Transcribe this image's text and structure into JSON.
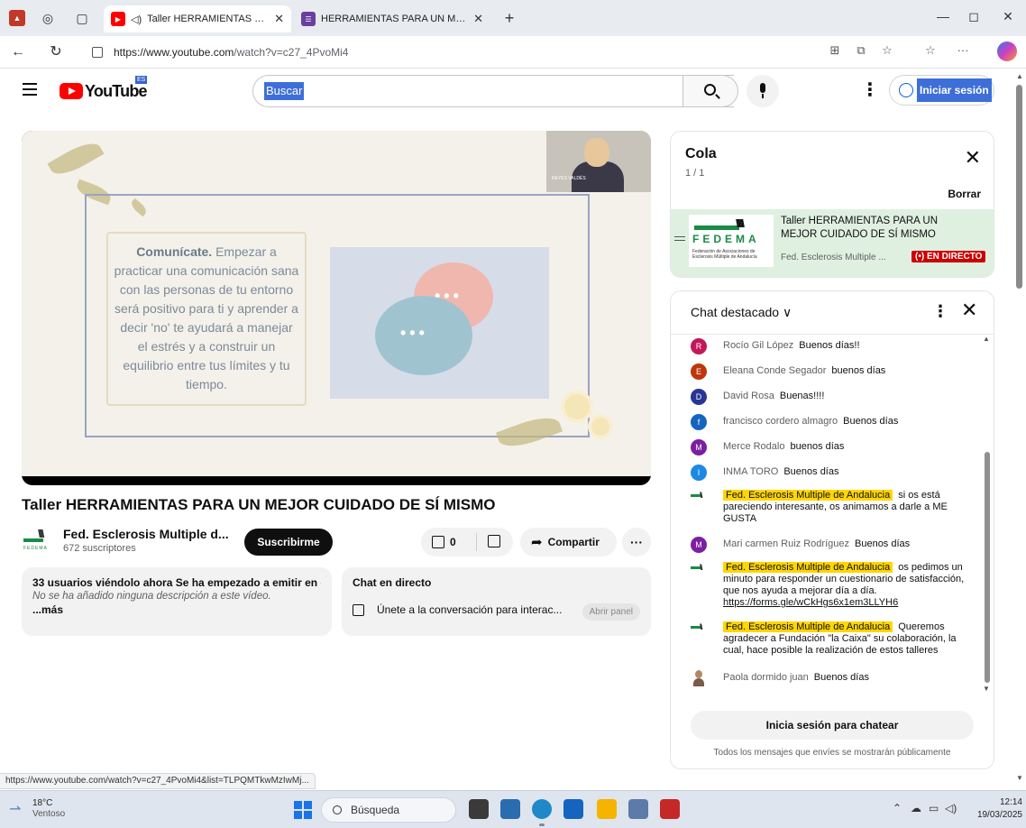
{
  "browser": {
    "tabs": [
      {
        "title": "Taller HERRAMIENTAS PARA UN MEJOR",
        "favicon": "youtube-icon",
        "active": true
      },
      {
        "title": "HERRAMIENTAS PARA UN MEJOR",
        "favicon": "forms-icon",
        "active": false
      }
    ],
    "new_tab_symbol": "+",
    "url_domain": "https://www.youtube.com",
    "url_path": "/watch?v=c27_4PvoMi4"
  },
  "youtube": {
    "wordmark": "YouTube",
    "country_code": "ES",
    "search_placeholder": "Buscar",
    "signin_label": "Iniciar sesión"
  },
  "slide": {
    "heading": "Comunícate.",
    "body": "Empezar a practicar una comunicación sana con las personas de tu entorno será positivo para ti y aprender a decir 'no' te ayudará a manejar el estrés y a construir un equilibrio entre tus límites y tu tiempo.",
    "presenter_label": "REYES VALDÉS",
    "dots": "•••"
  },
  "video": {
    "title": "Taller HERRAMIENTAS PARA UN MEJOR CUIDADO DE SÍ MISMO",
    "channel_name": "Fed. Esclerosis Multiple d...",
    "subscribers": "672 suscriptores",
    "subscribe_label": "Suscribirme",
    "like_count": "0",
    "share_label": "Compartir",
    "more_symbol": "···"
  },
  "description": {
    "line1": "33 usuarios viéndolo ahora  Se ha empezado a emitir en el",
    "line2": "No se ha añadido ninguna descripción a este vídeo.",
    "more_label": "...más"
  },
  "live_chat_card": {
    "title": "Chat en directo",
    "join_text": "Únete a la conversación para interac...",
    "open_panel_label": "Abrir panel"
  },
  "queue": {
    "title": "Cola",
    "count": "1 / 1",
    "clear_label": "Borrar",
    "item": {
      "title": "Taller HERRAMIENTAS PARA UN MEJOR CUIDADO DE SÍ MISMO",
      "channel": "Fed. Esclerosis Multiple ...",
      "live_badge": "(•) EN DIRECTO",
      "thumb_word": "FEDEMA",
      "thumb_sub": "Federación de Asociaciones de Esclerosis Múltiple de Andalucía"
    }
  },
  "chat": {
    "title": "Chat destacado ∨",
    "messages": [
      {
        "initial": "R",
        "color": "#c2185b",
        "author": "Rocío Gil López",
        "text": "Buenos días!!",
        "owner": false
      },
      {
        "initial": "E",
        "color": "#bf360c",
        "author": "Eleana Conde Segador",
        "text": "buenos días",
        "owner": false
      },
      {
        "initial": "D",
        "color": "#283593",
        "author": "David Rosa",
        "text": "Buenas!!!!",
        "owner": false
      },
      {
        "initial": "f",
        "color": "#1565c0",
        "author": "francisco cordero almagro",
        "text": "Buenos días",
        "owner": false
      },
      {
        "initial": "M",
        "color": "#7b1fa2",
        "author": "Merce Rodalo",
        "text": "buenos días",
        "owner": false
      },
      {
        "initial": "I",
        "color": "#1e88e5",
        "author": "INMA TORO",
        "text": "Buenos días",
        "owner": false
      },
      {
        "initial": "",
        "color": "#ffffff",
        "author": "Fed. Esclerosis Multiple de Andalucia",
        "text": "si os está pareciendo interesante, os animamos a darle a ME GUSTA",
        "owner": true
      },
      {
        "initial": "M",
        "color": "#7b1fa2",
        "author": "Mari carmen Ruiz Rodríguez",
        "text": "Buenos días",
        "owner": false
      },
      {
        "initial": "",
        "color": "#ffffff",
        "author": "Fed. Esclerosis Multiple de Andalucia",
        "text": "os pedimos un minuto para responder un cuestionario de satisfacción, que nos ayuda a mejorar día a día.",
        "link": "https://forms.gle/wCkHgs6x1em3LLYH6",
        "owner": true
      },
      {
        "initial": "",
        "color": "#ffffff",
        "author": "Fed. Esclerosis Multiple de Andalucia",
        "text": "Queremos agradecer a Fundación \"la Caixa\" su colaboración, la cual, hace posible la realización de estos talleres",
        "owner": true
      },
      {
        "initial": "",
        "color": "#ffffff",
        "author": "Paola dormido juan",
        "text": "Buenos días",
        "owner": false
      }
    ],
    "signin_label": "Inicia sesión para chatear",
    "footer": "Todos los mensajes que envíes se mostrarán públicamente"
  },
  "status_url": "https://www.youtube.com/watch?v=c27_4PvoMi4&list=TLPQMTkwMzIwMj...",
  "taskbar": {
    "temperature": "18°C",
    "condition": "Ventoso",
    "search_placeholder": "Búsqueda",
    "time": "12:14",
    "date": "19/03/2025"
  }
}
